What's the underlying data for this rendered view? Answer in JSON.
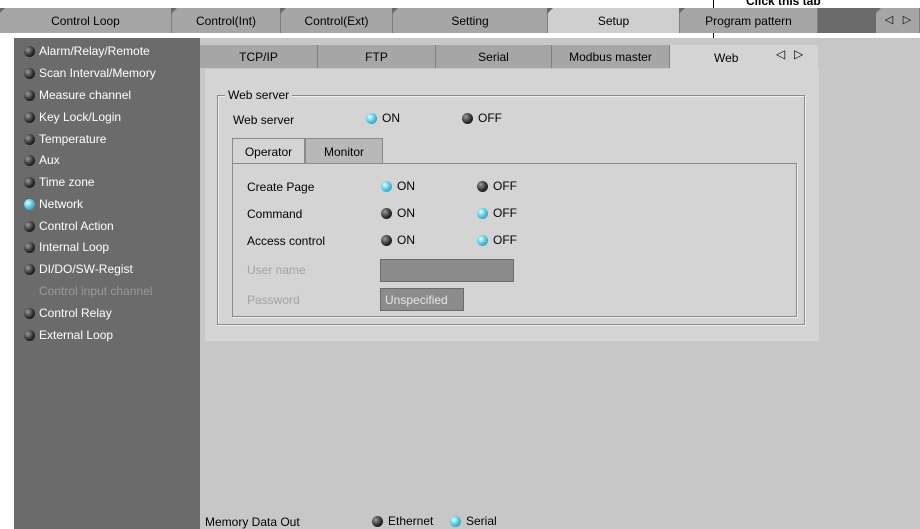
{
  "annotation": {
    "text": "Click this tab"
  },
  "top_tabs": [
    {
      "label": "Control Loop"
    },
    {
      "label": "Control(Int)"
    },
    {
      "label": "Control(Ext)"
    },
    {
      "label": "Setting"
    },
    {
      "label": "Setup",
      "active": true
    },
    {
      "label": "Program pattern"
    }
  ],
  "scroll_arrows": {
    "left": "◁",
    "right": "▷"
  },
  "sidebar": {
    "items": [
      {
        "label": "Alarm/Relay/Remote",
        "state": "off"
      },
      {
        "label": "Scan Interval/Memory",
        "state": "off"
      },
      {
        "label": "Measure channel",
        "state": "off"
      },
      {
        "label": "Key Lock/Login",
        "state": "off"
      },
      {
        "label": "Temperature",
        "state": "off"
      },
      {
        "label": "Aux",
        "state": "off"
      },
      {
        "label": "Time zone",
        "state": "off"
      },
      {
        "label": "Network",
        "state": "on"
      },
      {
        "label": "Control Action",
        "state": "off"
      },
      {
        "label": "Internal Loop",
        "state": "off"
      },
      {
        "label": "DI/DO/SW-Regist",
        "state": "off"
      },
      {
        "label": "Control input channel",
        "state": "disabled"
      },
      {
        "label": "Control Relay",
        "state": "off"
      },
      {
        "label": "External Loop",
        "state": "off"
      }
    ]
  },
  "sub_tabs": [
    {
      "label": "TCP/IP"
    },
    {
      "label": "FTP"
    },
    {
      "label": "Serial"
    },
    {
      "label": "Modbus master"
    },
    {
      "label": "Web",
      "active": true
    }
  ],
  "web_server": {
    "group_title": "Web server",
    "label": "Web server",
    "on_label": "ON",
    "off_label": "OFF",
    "selected": "ON"
  },
  "inner_tabs": {
    "operator": "Operator",
    "monitor": "Monitor"
  },
  "operator": {
    "create_page": {
      "label": "Create Page",
      "on": "ON",
      "off": "OFF",
      "selected": "ON"
    },
    "command": {
      "label": "Command",
      "on": "ON",
      "off": "OFF",
      "selected": "OFF"
    },
    "access_control": {
      "label": "Access control",
      "on": "ON",
      "off": "OFF",
      "selected": "OFF"
    },
    "user_name": {
      "label": "User name",
      "value": ""
    },
    "password": {
      "label": "Password",
      "value": "Unspecified"
    }
  },
  "footer": {
    "label": "Memory Data Out",
    "ethernet": "Ethernet",
    "serial": "Serial",
    "selected": "Serial"
  },
  "colors": {
    "accent_on": "#5cc9e0",
    "panel": "#c7c7c7",
    "sidebar": "#6b6b6b"
  }
}
